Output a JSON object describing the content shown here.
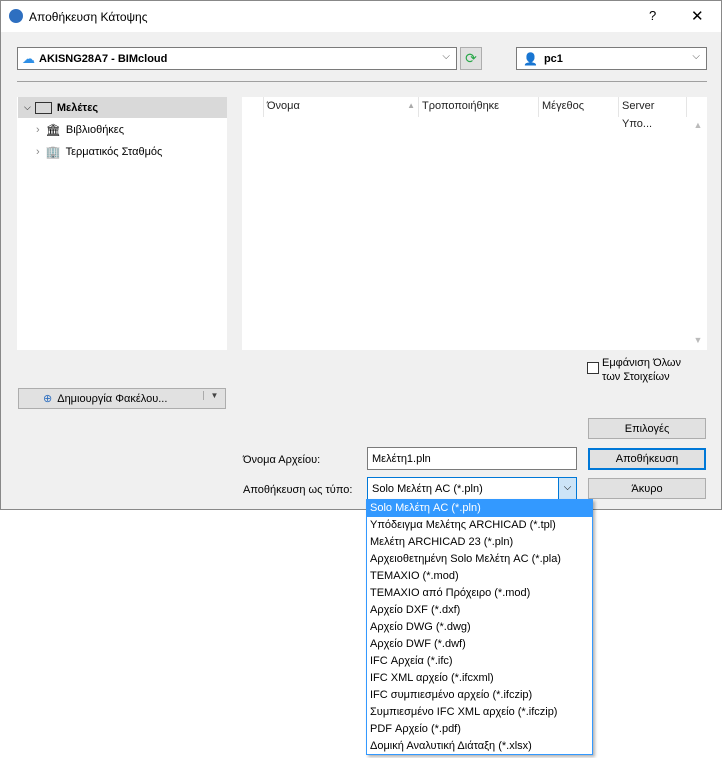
{
  "window": {
    "title": "Αποθήκευση Κάτοψης",
    "help": "?",
    "close": "✕"
  },
  "server": {
    "value": "AKISNG28A7 - BIMcloud"
  },
  "user": {
    "value": "pc1"
  },
  "tree": [
    {
      "label": "Μελέτες"
    },
    {
      "label": "Βιβλιοθήκες"
    },
    {
      "label": "Τερματικός Σταθμός"
    }
  ],
  "columns": [
    "Όνομα",
    "Τροποποιήθηκε",
    "Μέγεθος",
    "Server Υπο..."
  ],
  "show_all": {
    "line1": "Εμφάνιση Όλων",
    "line2": "των Στοιχείων"
  },
  "new_folder": "Δημιουργία Φακέλου...",
  "options_btn": "Επιλογές",
  "save_btn": "Αποθήκευση",
  "cancel_btn": "Άκυρο",
  "filename": {
    "label": "Όνομα Αρχείου:",
    "value": "Μελέτη1.pln"
  },
  "filetype": {
    "label": "Αποθήκευση ως τύπο:",
    "value": "Solo Μελέτη AC (*.pln)",
    "options": [
      "Solo Μελέτη AC (*.pln)",
      "Υπόδειγμα Μελέτης ARCHICAD (*.tpl)",
      "Μελέτη ARCHICAD 23 (*.pln)",
      "Αρχειοθετημένη Solo Μελέτη AC (*.pla)",
      "ΤΕΜΑΧΙΟ (*.mod)",
      "ΤΕΜΑΧΙΟ από Πρόχειρο (*.mod)",
      "Αρχείο DXF (*.dxf)",
      "Αρχείο DWG (*.dwg)",
      "Αρχείο DWF (*.dwf)",
      "IFC Αρχεία (*.ifc)",
      "IFC XML αρχείο (*.ifcxml)",
      "IFC συμπιεσμένο αρχείο (*.ifczip)",
      "Συμπιεσμένο IFC XML αρχείο (*.ifczip)",
      "PDF Αρχείο (*.pdf)",
      "Δομική Αναλυτική Διάταξη (*.xlsx)"
    ]
  }
}
